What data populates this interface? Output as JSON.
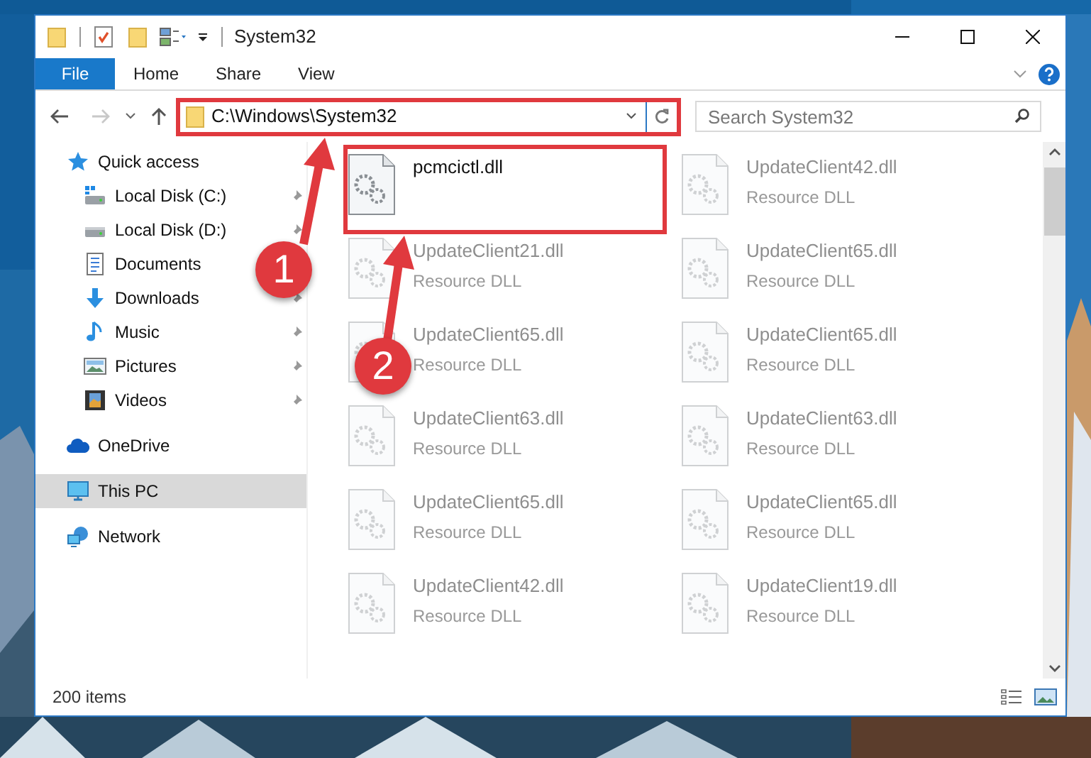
{
  "window": {
    "title": "System32"
  },
  "ribbon_tabs": [
    {
      "label": "File",
      "kind": "file"
    },
    {
      "label": "Home",
      "kind": "tab"
    },
    {
      "label": "Share",
      "kind": "tab"
    },
    {
      "label": "View",
      "kind": "tab"
    }
  ],
  "address_bar": {
    "path": "C:\\Windows\\System32"
  },
  "search": {
    "placeholder": "Search System32"
  },
  "navigation": [
    {
      "label": "Quick access",
      "kind": "star",
      "selected": false,
      "children": [
        {
          "label": "Local Disk (C:)",
          "kind": "systemdrive",
          "pinned": true
        },
        {
          "label": "Local Disk (D:)",
          "kind": "drive",
          "pinned": true
        },
        {
          "label": "Documents",
          "kind": "documents",
          "pinned": false
        },
        {
          "label": "Downloads",
          "kind": "downloads",
          "pinned": true
        },
        {
          "label": "Music",
          "kind": "music",
          "pinned": true
        },
        {
          "label": "Pictures",
          "kind": "pictures",
          "pinned": true
        },
        {
          "label": "Videos",
          "kind": "videos",
          "pinned": true
        }
      ]
    },
    {
      "label": "OneDrive",
      "kind": "cloud",
      "selected": false
    },
    {
      "label": "This PC",
      "kind": "pc",
      "selected": true
    },
    {
      "label": "Network",
      "kind": "network",
      "selected": false
    }
  ],
  "files": [
    {
      "name": "pcmcictl.dll",
      "blurred": false
    },
    {
      "name": "UpdateClient42.dll",
      "type": "Resource DLL",
      "blurred": true
    },
    {
      "name": "UpdateClient21.dll",
      "type": "Resource DLL",
      "blurred": true
    },
    {
      "name": "UpdateClient65.dll",
      "type": "Resource DLL",
      "blurred": true
    },
    {
      "name": "UpdateClient65.dll",
      "type": "Resource DLL",
      "blurred": true
    },
    {
      "name": "UpdateClient65.dll",
      "type": "Resource DLL",
      "blurred": true
    },
    {
      "name": "UpdateClient63.dll",
      "type": "Resource DLL",
      "blurred": true
    },
    {
      "name": "UpdateClient63.dll",
      "type": "Resource DLL",
      "blurred": true
    },
    {
      "name": "UpdateClient65.dll",
      "type": "Resource DLL",
      "blurred": true
    },
    {
      "name": "UpdateClient65.dll",
      "type": "Resource DLL",
      "blurred": true
    },
    {
      "name": "UpdateClient42.dll",
      "type": "Resource DLL",
      "blurred": true
    },
    {
      "name": "UpdateClient19.dll",
      "type": "Resource DLL",
      "blurred": true
    }
  ],
  "status_bar": {
    "item_count": "200 items"
  },
  "annotations": [
    {
      "number": "1"
    },
    {
      "number": "2"
    }
  ]
}
